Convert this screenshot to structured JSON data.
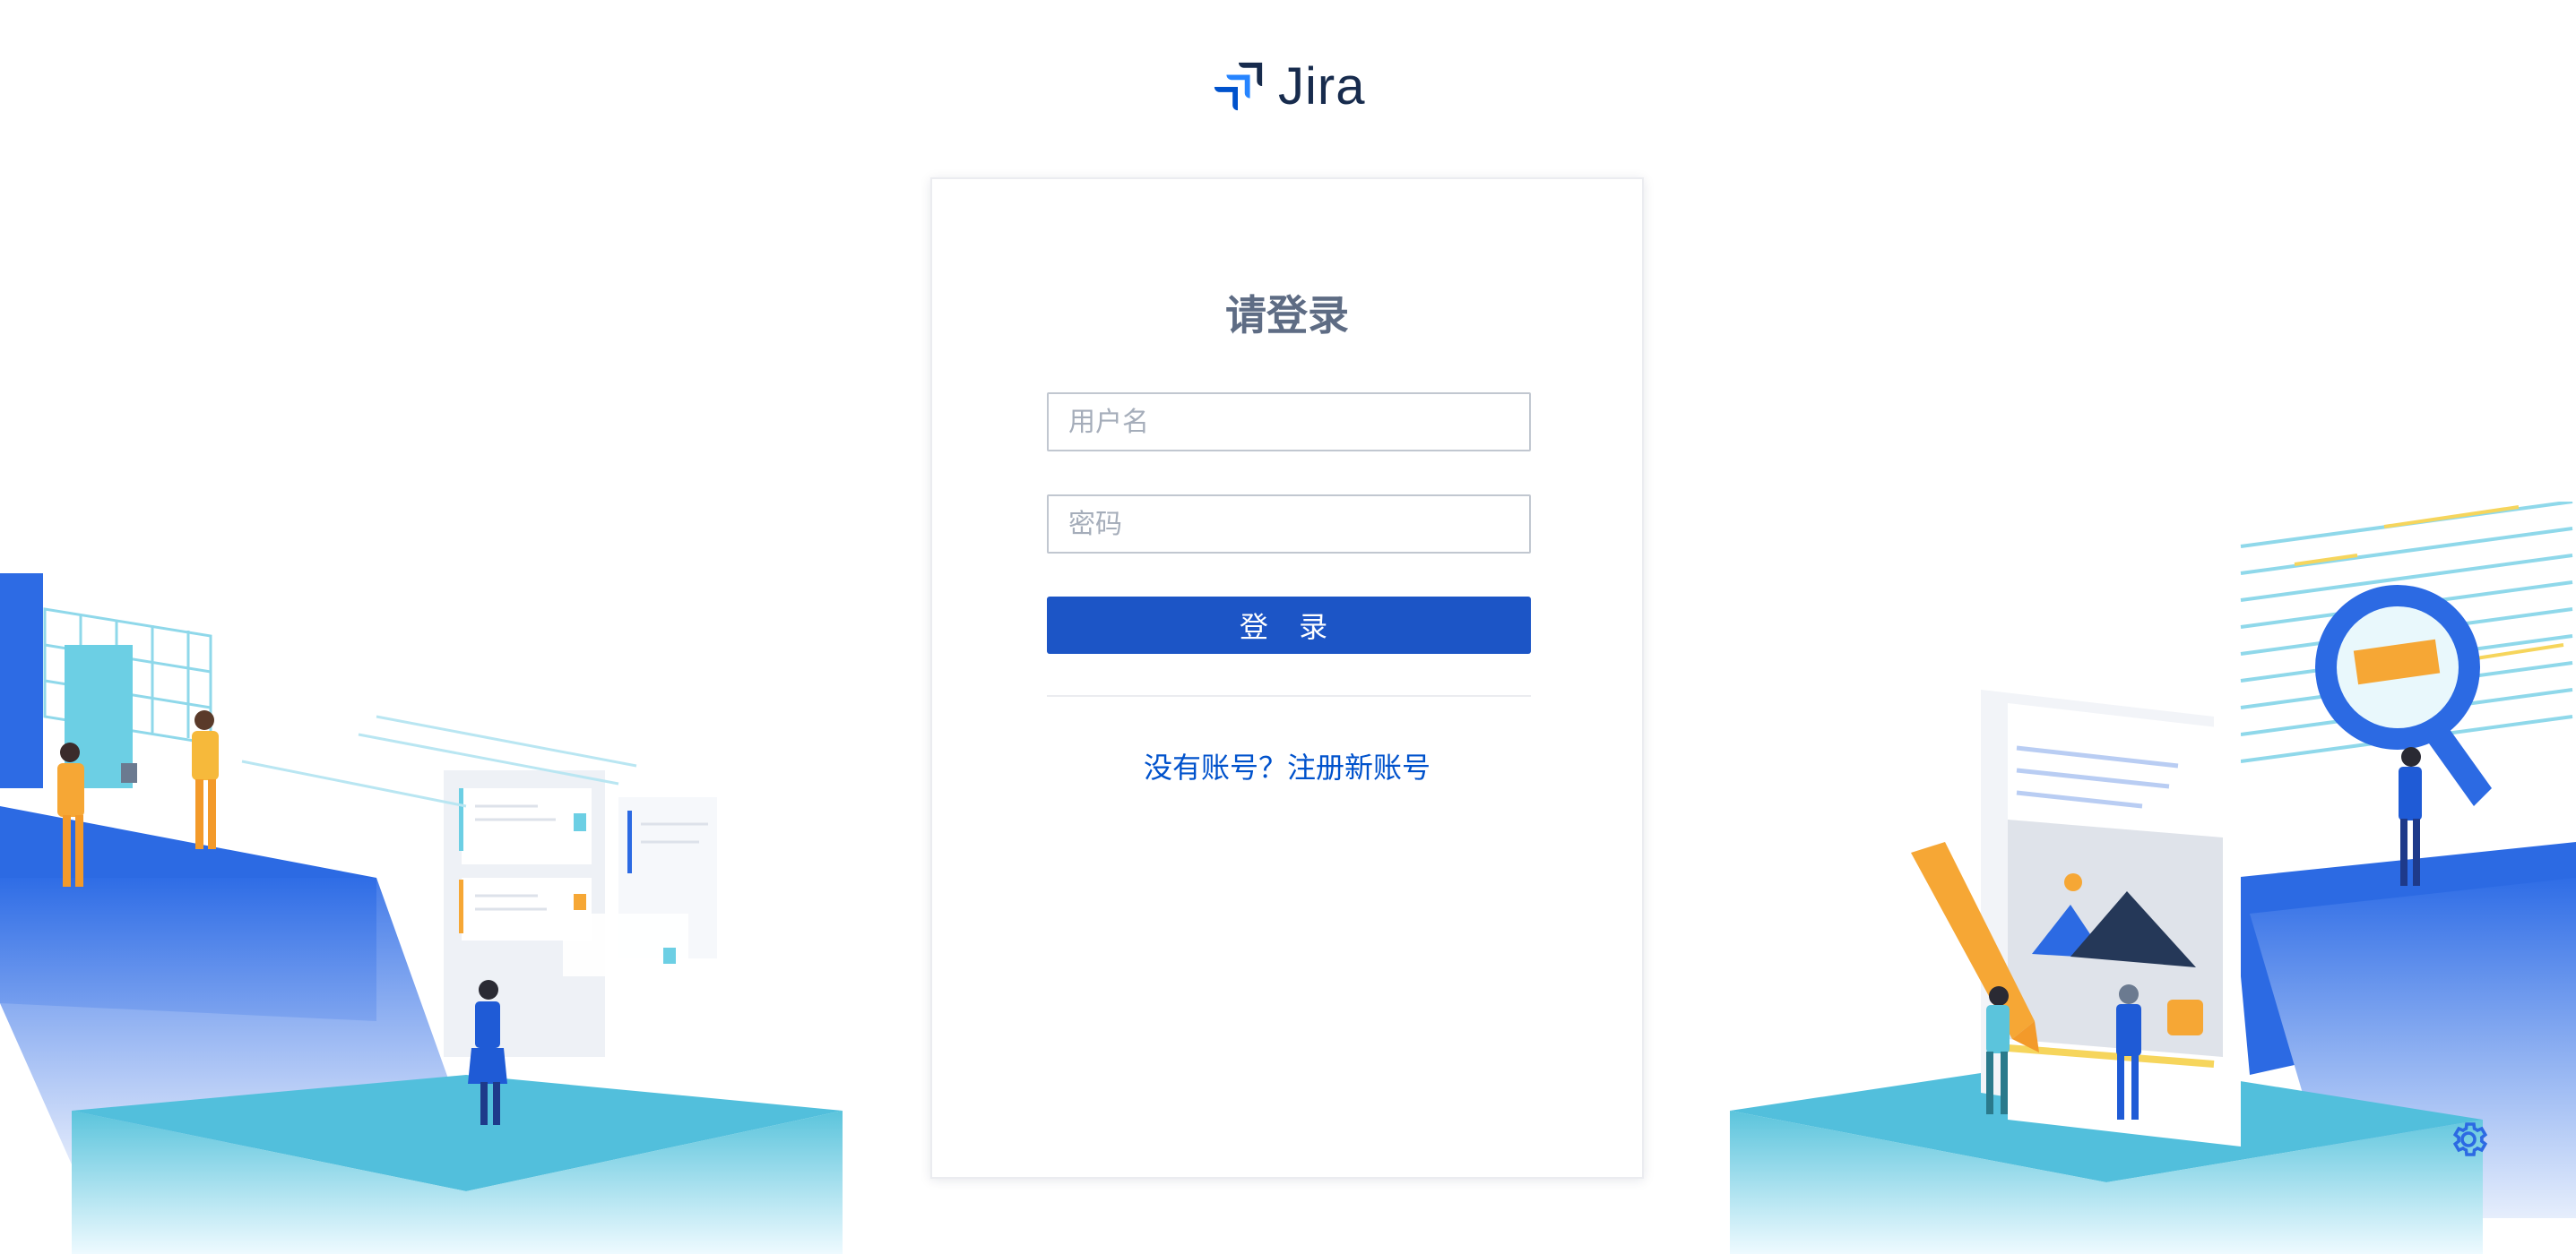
{
  "brand": {
    "name": "Jira",
    "logo_icon": "jira-logo-icon"
  },
  "login": {
    "title": "请登录",
    "username_placeholder": "用户名",
    "password_placeholder": "密码",
    "submit_label": "登 录",
    "signup_link": "没有账号？注册新账号"
  },
  "footer": {
    "settings_icon": "gear-icon"
  },
  "colors": {
    "primary": "#1c55c6",
    "link": "#0052cc",
    "title": "#5e6c84",
    "brand_dark": "#172b4d"
  }
}
